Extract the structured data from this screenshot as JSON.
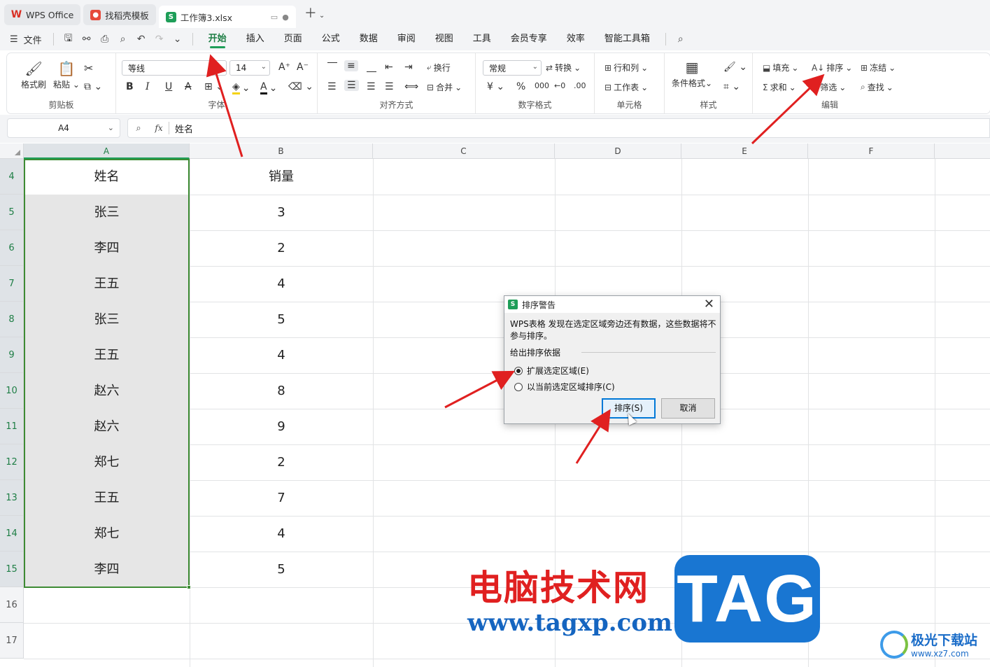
{
  "tabs": [
    {
      "label": "WPS Office",
      "icon": "wps-logo-icon",
      "active": false
    },
    {
      "label": "找稻壳模板",
      "icon": "docer-logo-icon",
      "active": false
    },
    {
      "label": "工作簿3.xlsx",
      "icon": "spreadsheet-logo-icon",
      "active": true
    }
  ],
  "menu": {
    "file": "文件",
    "tabs": [
      "开始",
      "插入",
      "页面",
      "公式",
      "数据",
      "审阅",
      "视图",
      "工具",
      "会员专享",
      "效率",
      "智能工具箱"
    ],
    "active_tab": "开始"
  },
  "ribbon": {
    "clipboard": {
      "format_painter": "格式刷",
      "paste": "粘贴",
      "group": "剪贴板"
    },
    "font": {
      "name": "等线",
      "size": "14",
      "group": "字体"
    },
    "align": {
      "wrap": "换行",
      "merge": "合并",
      "group": "对齐方式"
    },
    "number": {
      "format": "常规",
      "convert": "转换",
      "group": "数字格式"
    },
    "cells": {
      "rowcol": "行和列",
      "sheet": "工作表",
      "group": "单元格"
    },
    "styles": {
      "cond": "条件格式",
      "group": "样式"
    },
    "edit": {
      "fill": "填充",
      "sort": "排序",
      "freeze": "冻结",
      "sum": "求和",
      "filter": "筛选",
      "find": "查找",
      "group": "编辑"
    }
  },
  "formula_bar": {
    "cell_ref": "A4",
    "fx": "fx",
    "value": "姓名"
  },
  "grid": {
    "columns": [
      "A",
      "B",
      "C",
      "D",
      "E",
      "F"
    ],
    "rows": [
      {
        "num": "4",
        "a": "姓名",
        "b": "销量"
      },
      {
        "num": "5",
        "a": "张三",
        "b": "3"
      },
      {
        "num": "6",
        "a": "李四",
        "b": "2"
      },
      {
        "num": "7",
        "a": "王五",
        "b": "4"
      },
      {
        "num": "8",
        "a": "张三",
        "b": "5"
      },
      {
        "num": "9",
        "a": "王五",
        "b": "4"
      },
      {
        "num": "10",
        "a": "赵六",
        "b": "8"
      },
      {
        "num": "11",
        "a": "赵六",
        "b": "9"
      },
      {
        "num": "12",
        "a": "郑七",
        "b": "2"
      },
      {
        "num": "13",
        "a": "王五",
        "b": "7"
      },
      {
        "num": "14",
        "a": "郑七",
        "b": "4"
      },
      {
        "num": "15",
        "a": "李四",
        "b": "5"
      },
      {
        "num": "16",
        "a": "",
        "b": ""
      },
      {
        "num": "17",
        "a": "",
        "b": ""
      }
    ]
  },
  "dialog": {
    "title": "排序警告",
    "message": "WPS表格 发现在选定区域旁边还有数据，这些数据将不参与排序。",
    "group_label": "给出排序依据",
    "option_expand": "扩展选定区域(E)",
    "option_current": "以当前选定区域排序(C)",
    "selected": "expand",
    "sort_button": "排序(S)",
    "cancel_button": "取消"
  },
  "watermark": {
    "cn": "电脑技术网",
    "url": "www.tagxp.com",
    "tag": "TAG",
    "site_cn": "极光下载站",
    "site_url": "www.xz7.com"
  },
  "colors": {
    "accent": "#1e9e58",
    "selection": "#3d8b34",
    "arrow": "#e02020"
  }
}
